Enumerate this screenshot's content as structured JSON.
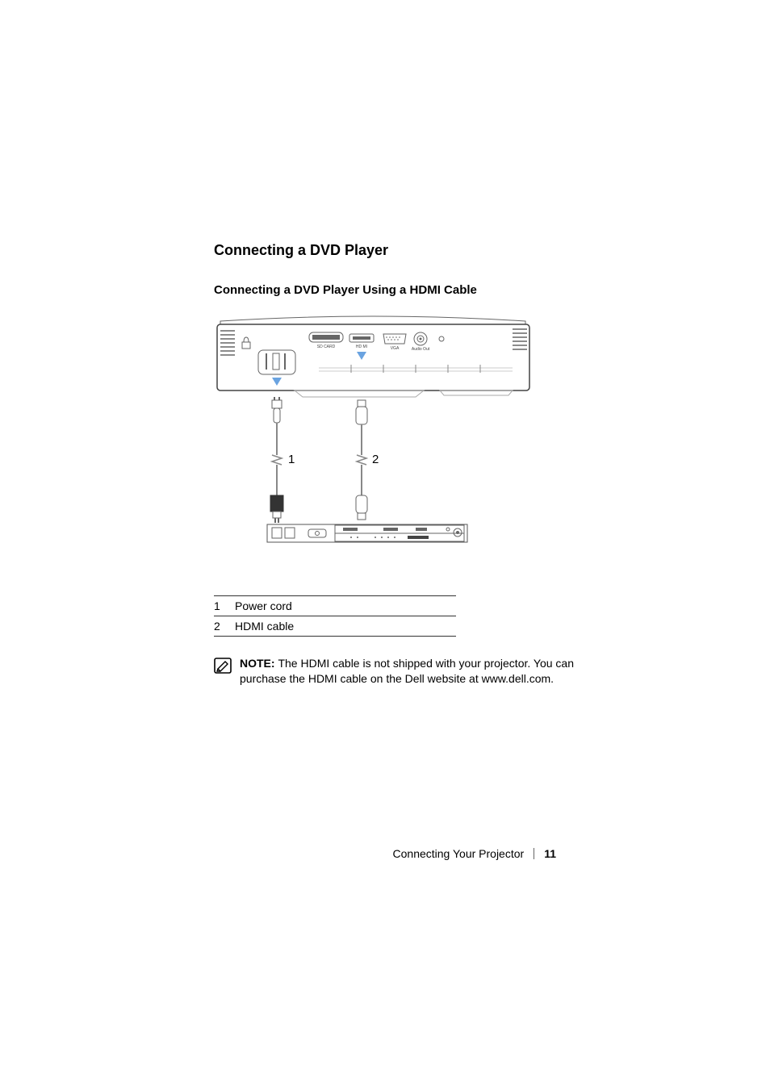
{
  "section_heading": "Connecting a DVD Player",
  "sub_heading": "Connecting a DVD Player Using a HDMI Cable",
  "diagram": {
    "port_labels": [
      "SD CARD",
      "HD MI",
      "VGA",
      "Audio Out"
    ],
    "callouts": [
      "1",
      "2"
    ]
  },
  "legend": [
    {
      "num": "1",
      "label": "Power cord"
    },
    {
      "num": "2",
      "label": "HDMI cable"
    }
  ],
  "note": {
    "icon": "pencil-note-icon",
    "prefix": "NOTE: ",
    "text": "The HDMI cable is not shipped with your projector. You can purchase the HDMI cable on the Dell website at www.dell.com."
  },
  "footer": {
    "chapter": "Connecting Your Projector",
    "page": "11"
  }
}
